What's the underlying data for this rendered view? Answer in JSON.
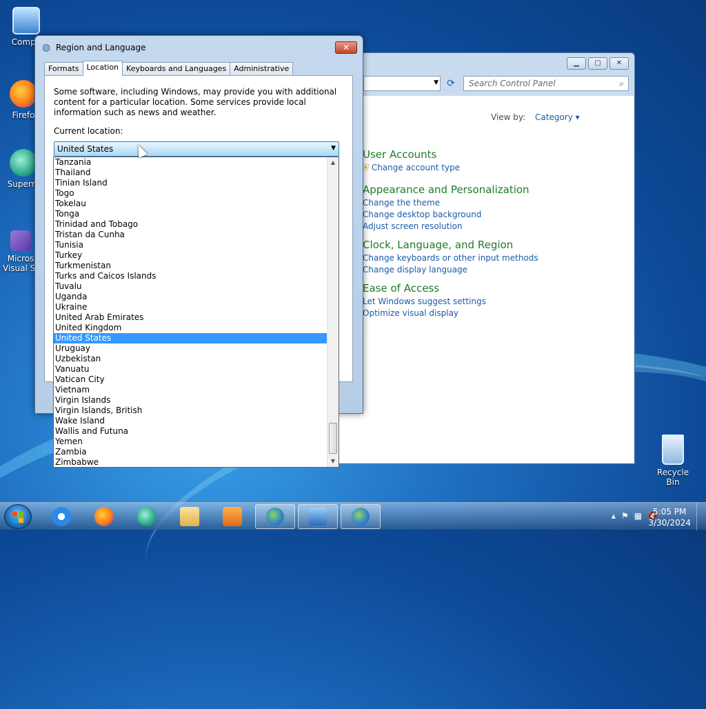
{
  "desktop": {
    "icons": [
      {
        "label": "Compu",
        "icon": "computer-icon"
      },
      {
        "label": "Firefo",
        "icon": "firefox-icon"
      },
      {
        "label": "Superm",
        "icon": "app-icon"
      },
      {
        "label": "Micros",
        "label2": "Visual St",
        "icon": "visual-studio-icon"
      }
    ],
    "recycle_bin": "Recycle Bin"
  },
  "control_panel": {
    "search_placeholder": "Search Control Panel",
    "view_by_label": "View by:",
    "view_by_value": "Category",
    "categories": [
      {
        "title": "User Accounts",
        "links": [
          "Change account type"
        ]
      },
      {
        "title": "Appearance and Personalization",
        "links": [
          "Change the theme",
          "Change desktop background",
          "Adjust screen resolution"
        ]
      },
      {
        "title": "Clock, Language, and Region",
        "links": [
          "Change keyboards or other input methods",
          "Change display language"
        ]
      },
      {
        "title": "Ease of Access",
        "links": [
          "Let Windows suggest settings",
          "Optimize visual display"
        ]
      }
    ]
  },
  "dialog": {
    "title": "Region and Language",
    "close": "✕",
    "tabs": [
      "Formats",
      "Location",
      "Keyboards and Languages",
      "Administrative"
    ],
    "active_tab": "Location",
    "intro": "Some software, including Windows, may provide you with additional content for a particular location. Some services provide local information such as news and weather.",
    "current_location_label": "Current location:",
    "current_location_value": "United States",
    "options": [
      "Tanzania",
      "Thailand",
      "Tinian Island",
      "Togo",
      "Tokelau",
      "Tonga",
      "Trinidad and Tobago",
      "Tristan da Cunha",
      "Tunisia",
      "Turkey",
      "Turkmenistan",
      "Turks and Caicos Islands",
      "Tuvalu",
      "Uganda",
      "Ukraine",
      "United Arab Emirates",
      "United Kingdom",
      "United States",
      "Uruguay",
      "Uzbekistan",
      "Vanuatu",
      "Vatican City",
      "Vietnam",
      "Virgin Islands",
      "Virgin Islands, British",
      "Wake Island",
      "Wallis and Futuna",
      "Yemen",
      "Zambia",
      "Zimbabwe"
    ],
    "selected_option": "United States"
  },
  "taskbar": {
    "time": "5:05 PM",
    "date": "3/30/2024"
  },
  "colors": {
    "link": "#1a5aa8",
    "category_title": "#1f7a28",
    "selection": "#3399ff"
  }
}
